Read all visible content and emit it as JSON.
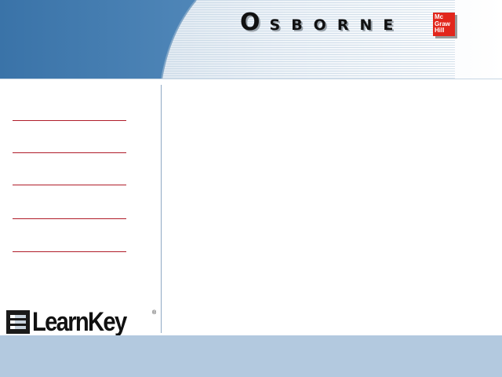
{
  "header": {
    "publisher_first": "O",
    "publisher_rest": "SBORNE",
    "parent_logo": [
      "Mc",
      "Graw",
      "Hill"
    ],
    "colors": {
      "banner_dark": "#3f78ab",
      "banner_light": "#dce8f2",
      "logo_red": "#e2261c"
    }
  },
  "sidebar": {
    "nav_items": [
      {
        "label": ""
      },
      {
        "label": ""
      },
      {
        "label": ""
      },
      {
        "label": ""
      },
      {
        "label": ""
      }
    ],
    "colors": {
      "rule": "#b01d2a"
    }
  },
  "branding": {
    "learnkey_text": "LearnKey",
    "registered": "®"
  },
  "footer": {
    "colors": {
      "background": "#b3c9df"
    }
  }
}
